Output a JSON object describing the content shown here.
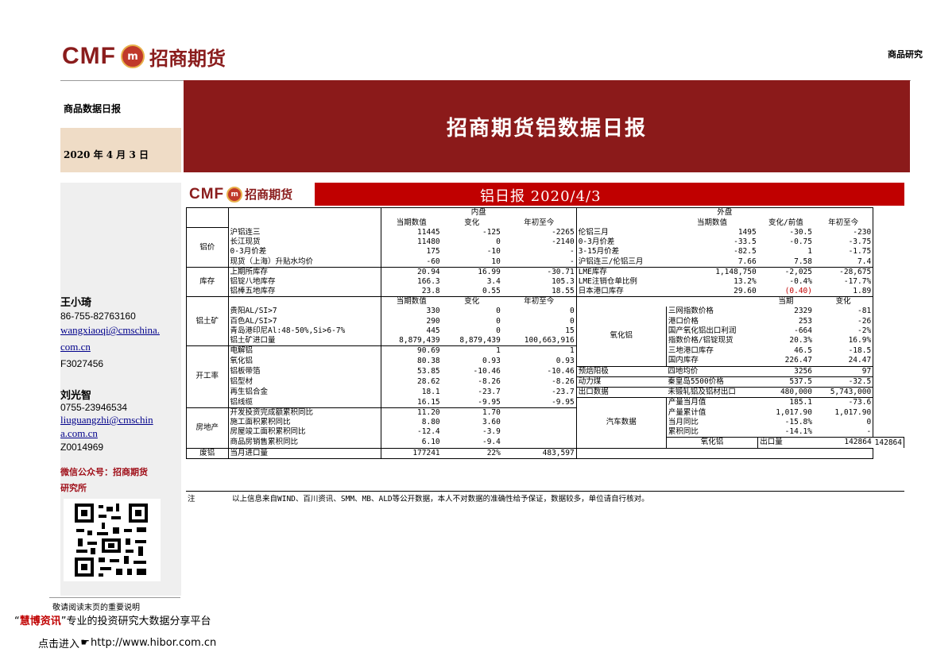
{
  "header": {
    "logo_cmf": "CMF",
    "logo_circle": "m",
    "logo_cn": "招商期货",
    "top_right": "商品研究",
    "category": "商品数据日报",
    "date": "2020 年 4 月 3 日",
    "banner_title": "招商期货铝数据日报"
  },
  "analysts": [
    {
      "name": "王小琦",
      "phone": "86-755-82763160",
      "email_1": "wangxiaoqi@cmschina.",
      "email_2": "com.cn",
      "license": "F3027456"
    },
    {
      "name": "刘光智",
      "phone": "0755-23946534",
      "email_1": "liuguangzhi@cmschin",
      "email_2": "a.com.cn",
      "license": "Z0014969"
    }
  ],
  "wechat_1": "微信公众号：招商期货",
  "wechat_2": "研究所",
  "footer": {
    "disclaimer": "敬请阅读末页的重要说明",
    "huibo_quote_open": "“",
    "huibo_name": "慧博资讯",
    "huibo_quote_close": "”",
    "huibo_rest": "专业的投资研究大数据分享平台",
    "hibor_prefix": "点击进入",
    "hibor_url": "http://www.hibor.com.cn"
  },
  "panel": {
    "logo_cmf": "CMF",
    "logo_cn": "招商期货",
    "title": "铝日报 2020/4/3",
    "note_label": "注",
    "note": "以上信息来自WIND、百川资讯、SMM、MB、ALD等公开数据，本人不对数据的准确性给予保证，数据较多，单位请自行核对。"
  },
  "table": {
    "domestic": "内盘",
    "foreign": "外盘",
    "h_cur": "当期数值",
    "h_chg": "变化",
    "h_ytd": "年初至今",
    "h_fchg": "变化/前值",
    "h_cur2": "当期",
    "h_chg2": "变化",
    "sec_price": "铝价",
    "sec_stock": "库存",
    "sec_ore": "铝土矿",
    "sec_oper": "开工率",
    "sec_estate": "房地产",
    "sec_scrap": "废铝",
    "sec_alumina": "氧化铝",
    "sec_auto": "汽车数据",
    "sec_alumina2": "氧化铝",
    "price_rows": [
      [
        "沪铝连三",
        "11445",
        "-125",
        "-2265",
        "伦铝三月",
        "1495",
        "-30.5",
        "-230"
      ],
      [
        "长江现货",
        "11480",
        "0",
        "-2140",
        "0-3月价差",
        "-33.5",
        "-0.75",
        "-3.75"
      ],
      [
        "0-3月价差",
        "175",
        "-10",
        "-",
        "3-15月价差",
        "-82.5",
        "1",
        "-1.75"
      ],
      [
        "现货（上海）升贴水均价",
        "-60",
        "10",
        "-",
        "沪铝连三/伦铝三月",
        "7.66",
        "7.58",
        "7.4"
      ]
    ],
    "stock_rows": [
      [
        "上期所库存",
        "20.94",
        "16.99",
        "-30.71",
        "LME库存",
        "1,148,750",
        "-2,025",
        "-28,675"
      ],
      [
        "铝锭八地库存",
        "166.3",
        "3.4",
        "105.3",
        "LME注销仓单比例",
        "13.2%",
        "-0.4%",
        "-17.7%"
      ],
      [
        "铝棒五地库存",
        "23.8",
        "0.55",
        "18.55",
        "日本港口库存",
        "29.60",
        "(0.40)",
        "1.89"
      ]
    ],
    "ore_rows": [
      [
        "贵阳AL/SI>7",
        "330",
        "0",
        "0",
        "三网指数价格",
        "2329",
        "-81"
      ],
      [
        "百色AL/SI>7",
        "290",
        "0",
        "0",
        "港口价格",
        "253",
        "-26"
      ],
      [
        "青岛港印尼Al:48-50%,Si>6-7%",
        "445",
        "0",
        "15",
        "国产氧化铝出口利润",
        "-664",
        "-2%"
      ],
      [
        "铝土矿进口量",
        "8,879,439",
        "8,879,439",
        "100,663,916",
        "指数价格/铝锭现货",
        "20.3%",
        "16.9%"
      ]
    ],
    "oper_rows": [
      [
        "电解铝",
        "90.69",
        "1",
        "1",
        "",
        "三地港口库存",
        "46.5",
        "-18.5"
      ],
      [
        "氧化铝",
        "80.38",
        "0.93",
        "0.93",
        "",
        "国内库存",
        "226.47",
        "24.47"
      ],
      [
        "铝板带箔",
        "53.85",
        "-10.46",
        "-10.46",
        "预焙阳极",
        "四地均价",
        "3256",
        "97"
      ],
      [
        "铝型材",
        "28.62",
        "-8.26",
        "-8.26",
        "动力煤",
        "秦皇岛5500价格",
        "537.5",
        "-32.5"
      ],
      [
        "再生铝合金",
        "18.1",
        "-23.7",
        "-23.7",
        "出口数据",
        "未锻轧铝及铝材出口",
        "480,000",
        "5,743,000"
      ],
      [
        "铝线缆",
        "16.15",
        "-9.95",
        "-9.95",
        "",
        "产量当月值",
        "185.1",
        "-73.6"
      ]
    ],
    "estate_rows": [
      [
        "开发投资完成额累积同比",
        "11.20",
        "1.70",
        "",
        "产量累计值",
        "1,017.90",
        "1,017.90"
      ],
      [
        "施工面积累积同比",
        "8.80",
        "3.60",
        "",
        "当月同比",
        "-15.8%",
        "0"
      ],
      [
        "房屋竣工面积累积同比",
        "-12.4",
        "-3.9",
        "",
        "累积同比",
        "-14.1%",
        "-"
      ],
      [
        "商品房销售累积同比",
        "6.10",
        "-9.4",
        "",
        "出口量",
        "142864",
        "142864"
      ]
    ],
    "scrap_row": [
      "当月进口量",
      "177241",
      "22%",
      "483,597"
    ]
  },
  "colors": {
    "brand": "#8b1a1a",
    "panel_red": "#c00000",
    "date_band": "#efdcc6",
    "sidebar": "#efefef"
  }
}
